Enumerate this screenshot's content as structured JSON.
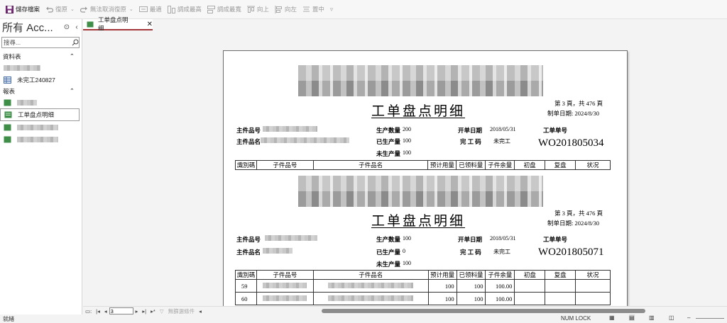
{
  "toolbar": {
    "save": "儲存檔案",
    "undo": "復原",
    "redo": "無法取消復原",
    "align_grid": "最適",
    "to_tallest": "調成最高",
    "to_shortest": "調成最寬",
    "align_top": "向上",
    "align_left": "向左",
    "center": "置中"
  },
  "nav": {
    "title": "所有 Acc...",
    "search_placeholder": "搜尋...",
    "group_tables": "資料表",
    "table_item": "未完工240827",
    "group_reports": "報表",
    "report_item": "工单盘点明细"
  },
  "tab": {
    "label": "工单盘点明细"
  },
  "report": {
    "title": "工单盘点明细",
    "blocks": [
      {
        "page": "第 3 頁，共 476 頁",
        "made_date": "制单日期: 2024/8/30",
        "labels": {
          "main_no": "主件品号",
          "main_name": "主件品名",
          "prod_qty": "生产数量",
          "done_qty": "已生产量",
          "undone_qty": "未生产量",
          "open_date": "开单日期",
          "code": "完 工 码",
          "order_no": "工单单号"
        },
        "prod_qty": "200",
        "done_qty": "100",
        "undone_qty": "100",
        "open_date": "2018/05/31",
        "code": "未完工",
        "wo": "WO201805034"
      },
      {
        "page": "第 3 頁，共 476 頁",
        "made_date": "制单日期: 2024/8/30",
        "labels": {
          "main_no": "主件品号",
          "main_name": "主件品名",
          "prod_qty": "生产数量",
          "done_qty": "已生产量",
          "undone_qty": "未生产量",
          "open_date": "开单日期",
          "code": "完 工 码",
          "order_no": "工单单号"
        },
        "prod_qty": "100",
        "done_qty": "0",
        "undone_qty": "100",
        "open_date": "2018/05/31",
        "code": "未完工",
        "wo": "WO201805071"
      }
    ],
    "columns": [
      "識別碼",
      "子件品号",
      "子件品名",
      "预计用量",
      "已领料量",
      "子件余量",
      "初盘",
      "复盘",
      "状况"
    ],
    "rows": [
      {
        "id": "59",
        "plan": "100",
        "issued": "100",
        "left": "100.00"
      },
      {
        "id": "60",
        "plan": "100",
        "issued": "100",
        "left": "100.00"
      }
    ]
  },
  "recnav": {
    "current": "3",
    "nofilter": "無篩選條件"
  },
  "status": {
    "left": "就緒",
    "numlock": "NUM LOCK"
  }
}
